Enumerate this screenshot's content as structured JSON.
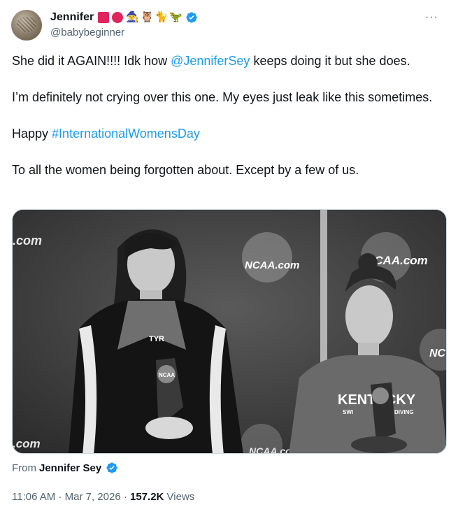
{
  "author": {
    "display_name": "Jennifer",
    "emojis": [
      "red-square",
      "red-circle",
      "mage",
      "owl",
      "black-cat",
      "t-rex"
    ],
    "handle": "@babybeginner",
    "verified": true
  },
  "more_label": "···",
  "tweet": {
    "p1_before": "She did it AGAIN!!!! Idk how ",
    "p1_mention": "@JenniferSey",
    "p1_after": " keeps doing it but she does.",
    "p2": "I’m definitely not crying over this one.  My eyes just leak like this sometimes.",
    "p3_before": "Happy ",
    "p3_hashtag": "#InternationalWomensDay",
    "p4": "To all the women being forgotten about.  Except by a few of us."
  },
  "media": {
    "description_type": "black-and-white photo",
    "banner_text_left": ".com",
    "banner_text_center": "NCAA.com",
    "banner_text_right": "NCAA.com",
    "banner_text_bottom_left": ".com",
    "banner_text_bottom_center": "NCAA.co",
    "banner_text_far_right": "NC",
    "shirt_text": "KENTUCKY",
    "shirt_sub_left": "SWI",
    "shirt_sub_right": "DIVING",
    "trophy_label": "NCAA",
    "jacket_logo": "TYR"
  },
  "attribution": {
    "prefix": "From",
    "name": "Jennifer Sey",
    "verified": true
  },
  "meta": {
    "time": "11:06 AM",
    "sep1": "·",
    "date": "Mar 7, 2026",
    "sep2": "·",
    "views_count": "157.2K",
    "views_label": "Views"
  },
  "colors": {
    "link": "#1d9bf0",
    "verified": "#1d9bf0",
    "secondary_text": "#536471",
    "primary_text": "#0f1419"
  }
}
